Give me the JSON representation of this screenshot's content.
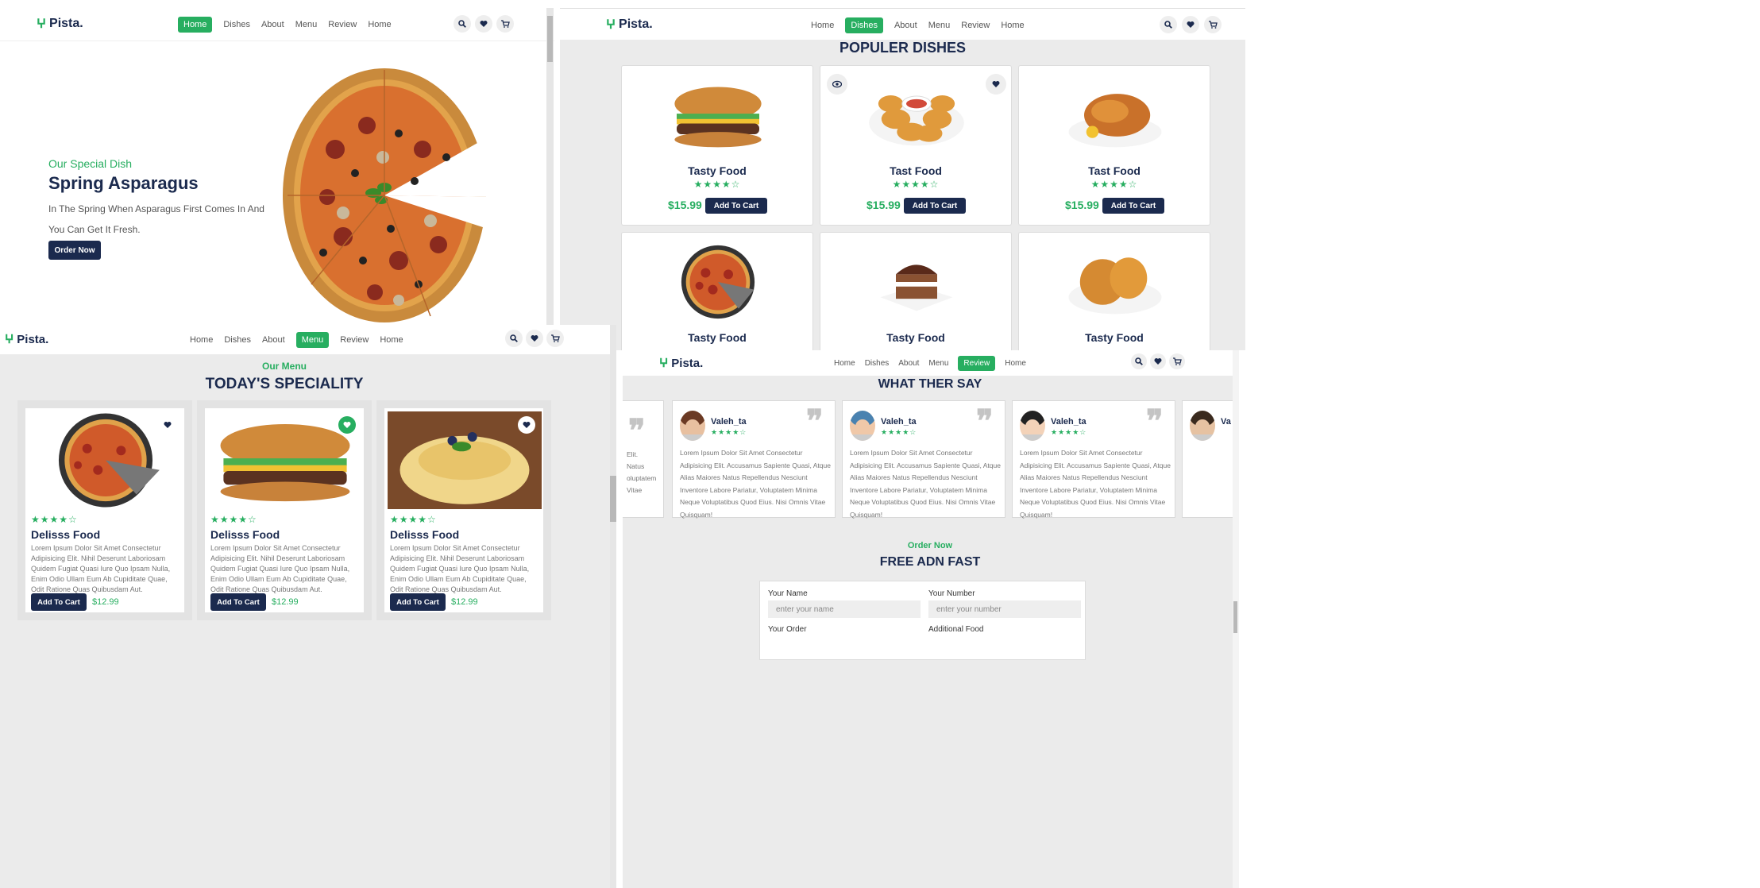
{
  "brand": {
    "name": "Pista.",
    "accent": "#27ae60",
    "dark": "#1b2a4e"
  },
  "nav_links": [
    "Home",
    "Dishes",
    "About",
    "Menu",
    "Review",
    "Home"
  ],
  "nav_icons": [
    "search-icon",
    "heart-icon",
    "cart-icon"
  ],
  "panels": {
    "home": {
      "active_link": "Home"
    },
    "dishes": {
      "active_link": "Dishes"
    },
    "menu": {
      "active_link": "Menu"
    },
    "review": {
      "active_link": "Review"
    }
  },
  "hero": {
    "subtitle": "Our Special Dish",
    "title": "Spring Asparagus",
    "text": "In The Spring When Asparagus First Comes In And You Can Get It Fresh.",
    "button": "Order Now"
  },
  "dishes": {
    "heading": "POPULER DISHES",
    "items": [
      {
        "name": "Tasty Food",
        "price": "$15.99",
        "button": "Add To Cart",
        "rating": 4.5,
        "image": "burger"
      },
      {
        "name": "Tast Food",
        "price": "$15.99",
        "button": "Add To Cart",
        "rating": 4.5,
        "image": "nuggets"
      },
      {
        "name": "Tast Food",
        "price": "$15.99",
        "button": "Add To Cart",
        "rating": 4.5,
        "image": "chicken"
      },
      {
        "name": "Tasty Food",
        "image": "pizza"
      },
      {
        "name": "Tasty Food",
        "image": "cake"
      },
      {
        "name": "Tasty Food",
        "image": "fried-chicken"
      }
    ]
  },
  "menu": {
    "subtitle": "Our Menu",
    "heading": "TODAY'S SPECIALITY",
    "items": [
      {
        "name": "Delisss Food",
        "price": "$12.99",
        "button": "Add To Cart",
        "rating": 4.5,
        "image": "pizza",
        "liked": false,
        "desc": "Lorem Ipsum Dolor Sit Amet Consectetur Adipisicing Elit. Nihil Deserunt Laboriosam Quidem Fugiat Quasi Iure Quo Ipsam Nulla, Enim Odio Ullam Eum Ab Cupiditate Quae, Odit Ratione Quas Quibusdam Aut."
      },
      {
        "name": "Delisss Food",
        "price": "$12.99",
        "button": "Add To Cart",
        "rating": 4.5,
        "image": "burger",
        "liked": true,
        "desc": "Lorem Ipsum Dolor Sit Amet Consectetur Adipisicing Elit. Nihil Deserunt Laboriosam Quidem Fugiat Quasi Iure Quo Ipsam Nulla, Enim Odio Ullam Eum Ab Cupiditate Quae, Odit Ratione Quas Quibusdam Aut."
      },
      {
        "name": "Delisss Food",
        "price": "$12.99",
        "button": "Add To Cart",
        "rating": 4.5,
        "image": "crepe",
        "liked": false,
        "desc": "Lorem Ipsum Dolor Sit Amet Consectetur Adipisicing Elit. Nihil Deserunt Laboriosam Quidem Fugiat Quasi Iure Quo Ipsam Nulla, Enim Odio Ullam Eum Ab Cupiditate Quae, Odit Ratione Quas Quibusdam Aut."
      }
    ]
  },
  "reviews": {
    "heading": "WHAT THER SAY",
    "items": [
      {
        "name": "Valeh_ta",
        "rating": 4.5,
        "text": "Lorem Ipsum Dolor Sit Amet Consectetur Adipisicing Elit. Accusamus Sapiente Quasi, Atque Alias Maiores Natus Repellendus Nesciunt Inventore Labore Pariatur, Voluptatem Minima Neque Voluptatibus Quod Eius. Nisi Omnis Vitae Quisquam!"
      },
      {
        "name": "Valeh_ta",
        "rating": 4.5,
        "text": "Lorem Ipsum Dolor Sit Amet Consectetur Adipisicing Elit. Accusamus Sapiente Quasi, Atque Alias Maiores Natus Repellendus Nesciunt Inventore Labore Pariatur, Voluptatem Minima Neque Voluptatibus Quod Eius. Nisi Omnis Vitae Quisquam!"
      },
      {
        "name": "Valeh_ta",
        "rating": 4.5,
        "text": "Lorem Ipsum Dolor Sit Amet Consectetur Adipisicing Elit. Accusamus Sapiente Quasi, Atque Alias Maiores Natus Repellendus Nesciunt Inventore Labore Pariatur, Voluptatem Minima Neque Voluptatibus Quod Eius. Nisi Omnis Vitae Quisquam!"
      },
      {
        "name": "Va"
      }
    ],
    "partial_left": [
      "Elit.",
      "Natus",
      "oluptatem",
      "Vitae"
    ]
  },
  "order": {
    "subtitle": "Order Now",
    "heading": "FREE ADN FAST",
    "name_label": "Your Name",
    "name_placeholder": "enter your name",
    "number_label": "Your Number",
    "number_placeholder": "enter your number",
    "order_label": "Your Order",
    "food_label": "Additional Food"
  }
}
